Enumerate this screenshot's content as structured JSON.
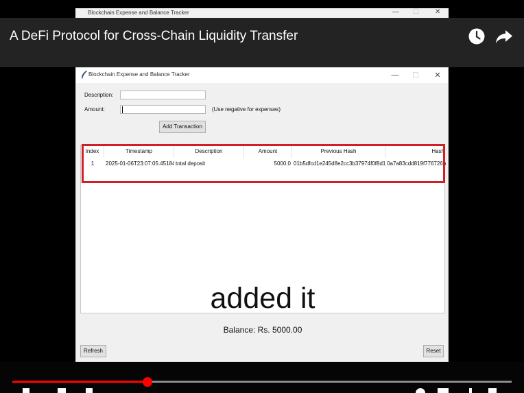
{
  "background_window": {
    "title": "Blockchain Expense and Balance Tracker",
    "minimize": "—",
    "maximize": "☐",
    "close": "✕"
  },
  "video": {
    "title": "A DeFi Protocol for Cross-Chain Liquidity Transfer",
    "caption": "added it",
    "progress": 0.27
  },
  "window": {
    "title": "Blockchain Expense and Balance Tracker",
    "minimize": "—",
    "maximize": "☐",
    "close": "✕"
  },
  "form": {
    "description_label": "Description:",
    "description_value": "",
    "amount_label": "Amount:",
    "amount_value": "",
    "amount_hint": "(Use negative for expenses)",
    "add_button": "Add Transaction"
  },
  "table": {
    "columns": [
      "Index",
      "Timestamp",
      "Description",
      "Amount",
      "Previous Hash",
      "Hash"
    ],
    "rows": [
      {
        "index": "1",
        "timestamp": "2025-01-06T23:07:05.451842",
        "description": "total deposit",
        "amount": "5000.0",
        "previous_hash": "01b5dfcd1e245d8e2cc3b37974f0f8d1",
        "hash": "0a7a83cdd819f776726b"
      }
    ]
  },
  "balance": "Balance: Rs. 5000.00",
  "buttons": {
    "refresh": "Refresh",
    "reset": "Reset"
  },
  "colors": {
    "highlight": "#d11f26",
    "progress": "#ff0000"
  }
}
